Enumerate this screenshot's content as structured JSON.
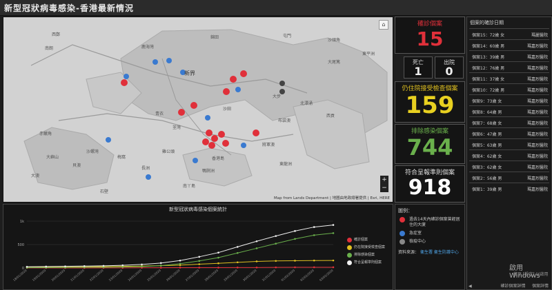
{
  "title": "新型冠狀病毒感染-香港最新情況",
  "map": {
    "home_icon": "home-icon",
    "zoom_in": "+",
    "zoom_out": "−",
    "attribution": "Map from Lands Department | 地圖由地政總署提供 | Esri, HERE",
    "region_label": "新界",
    "place_labels": [
      "西鄭",
      "鹿海灣",
      "屯門",
      "錦田",
      "沙頭角",
      "大步",
      "北潭涌",
      "赤鱲角",
      "大嶼山",
      "青衣",
      "荃灣",
      "沙田",
      "西貢",
      "香港島",
      "大澳",
      "長洲",
      "南丫島",
      "石壁",
      "將軍澳",
      "東龍洲",
      "布袋澳",
      "鴨脷洲",
      "南朗",
      "貝澳",
      "大尾篤",
      "東平洲",
      "雞公頭",
      "梅窩",
      "沙螺灣"
    ]
  },
  "stats": {
    "confirmed_label": "確診個案",
    "confirmed_value": "15",
    "death_label": "死亡",
    "death_value": "1",
    "discharged_label": "出院",
    "discharged_value": "0",
    "hospital_label": "仍住院接受檢查個案",
    "hospital_value": "159",
    "excluded_label": "排除感染個案",
    "excluded_value": "744",
    "reported_label": "符合呈報準則個案",
    "reported_value": "918"
  },
  "case_list": {
    "header": "個案的確診日期",
    "rows": [
      {
        "left": "個案15：72歲 女",
        "right": "瑪麗醫院"
      },
      {
        "left": "個案14：60歲 男",
        "right": "瑪嘉烈醫院"
      },
      {
        "left": "個案13：39歲 男",
        "right": "瑪嘉烈醫院"
      },
      {
        "left": "個案12：76歲 男",
        "right": "瑪嘉烈醫院"
      },
      {
        "left": "個案11：37歲 女",
        "right": "瑪嘉烈醫院"
      },
      {
        "left": "個案10：72歲 男",
        "right": "瑪嘉烈醫院"
      },
      {
        "left": "個案9：73歲 女",
        "right": "瑪嘉烈醫院"
      },
      {
        "left": "個案8：64歲 男",
        "right": "瑪嘉烈醫院"
      },
      {
        "left": "個案7：68歲 女",
        "right": "瑪嘉烈醫院"
      },
      {
        "left": "個案6：47歲 男",
        "right": "瑪嘉烈醫院"
      },
      {
        "left": "個案5：63歲 男",
        "right": "瑪嘉烈醫院"
      },
      {
        "left": "個案4：62歲 女",
        "right": "瑪嘉烈醫院"
      },
      {
        "left": "個案3：62歲 女",
        "right": "瑪嘉烈醫院"
      },
      {
        "left": "個案2：56歲 男",
        "right": "瑪嘉烈醫院"
      },
      {
        "left": "個案1：39歲 男",
        "right": "瑪嘉烈醫院"
      }
    ],
    "footer": "確診個案詳情",
    "footer_right": "個案詳情"
  },
  "legend_panel": {
    "title": "圖例：",
    "items": [
      {
        "label": "過去14天內確診個案曾經居住的大廈",
        "color": "#e0303a"
      },
      {
        "label": "急症室",
        "color": "#3a7ad0"
      },
      {
        "label": "檢疫中心",
        "color": "#888888"
      }
    ],
    "source_label": "資料來源：",
    "source_link": "衞生署 衞生防護中心"
  },
  "watermark": {
    "line1": "啟用 Windows",
    "line2": "移至 [設定] 以啟用"
  },
  "chart_data": {
    "type": "line",
    "title": "新型冠狀病毒感染個案統計",
    "x": [
      "18/01/2020",
      "19/01/2020",
      "20/01/2020",
      "21/01/2020",
      "22/01/2020",
      "23/01/2020",
      "24/01/2020",
      "25/01/2020",
      "26/01/2020",
      "27/01/2020",
      "28/01/2020",
      "29/01/2020",
      "30/01/2020",
      "31/01/2020",
      "01/02/2020",
      "02/02/2020",
      "03/02/2020"
    ],
    "x_tick_labels": [
      "18/01/2020",
      "19/01/2020",
      "20/01/2020",
      "21/01/2020",
      "22/01/2020",
      "23/01/2020",
      "24/01/2020",
      "25/01/2020",
      "26/01/2020",
      "27/01/2020",
      "28/01/2020",
      "29/01/2020",
      "30/01/2020",
      "31/01/2020",
      "01/02/2020",
      "02/02/2020",
      "03/02/2020"
    ],
    "y_ticks": [
      "0",
      "500",
      "1k"
    ],
    "ylim": [
      0,
      1000
    ],
    "series": [
      {
        "name": "確診個案",
        "color": "#e0303a",
        "values": [
          0,
          0,
          0,
          0,
          1,
          2,
          5,
          5,
          8,
          8,
          8,
          10,
          10,
          12,
          14,
          15,
          15
        ]
      },
      {
        "name": "仍在院接受檢查個案",
        "color": "#e0c020",
        "values": [
          20,
          22,
          25,
          28,
          30,
          35,
          40,
          50,
          60,
          80,
          100,
          120,
          140,
          150,
          155,
          159,
          160
        ]
      },
      {
        "name": "排除感染個案",
        "color": "#6ab04c",
        "values": [
          5,
          8,
          10,
          12,
          15,
          20,
          30,
          50,
          90,
          150,
          220,
          320,
          420,
          520,
          620,
          700,
          744
        ]
      },
      {
        "name": "符合呈報準則個案",
        "color": "#f0f0f0",
        "values": [
          25,
          30,
          35,
          40,
          46,
          57,
          75,
          105,
          158,
          238,
          328,
          450,
          570,
          682,
          789,
          874,
          918
        ]
      }
    ]
  }
}
